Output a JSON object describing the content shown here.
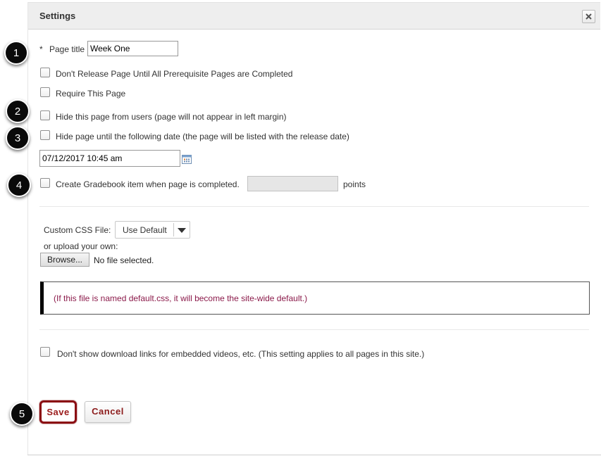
{
  "dialog": {
    "title": "Settings"
  },
  "steps": [
    "1",
    "2",
    "3",
    "4",
    "5"
  ],
  "fields": {
    "page_title_required": "*",
    "page_title_label": "Page title",
    "page_title_value": "Week One",
    "prereq_label": "Don't Release Page Until All Prerequisite Pages are Completed",
    "require_label": "Require This Page",
    "hide_label": "Hide this page from users (page will not appear in left margin)",
    "hide_until_label": "Hide page until the following date (the page will be listed with the release date)",
    "release_date_value": "07/12/2017 10:45 am",
    "gradebook_label": "Create Gradebook item when page is completed.",
    "gradebook_points_value": "",
    "points_label": "points"
  },
  "css": {
    "label": "Custom CSS File:",
    "selected": "Use Default",
    "upload_label": "or upload your own:",
    "browse_label": "Browse...",
    "no_file": "No file selected.",
    "note": "(If this file is named default.css, it will become the site-wide default.)"
  },
  "download_label": "Don't show download links for embedded videos, etc. (This setting applies to all pages in this site.)",
  "buttons": {
    "save": "Save",
    "cancel": "Cancel"
  },
  "colors": {
    "save_border": "#8b0d13",
    "note_text": "#8b1a4a",
    "header_bg": "#eeeeee"
  }
}
